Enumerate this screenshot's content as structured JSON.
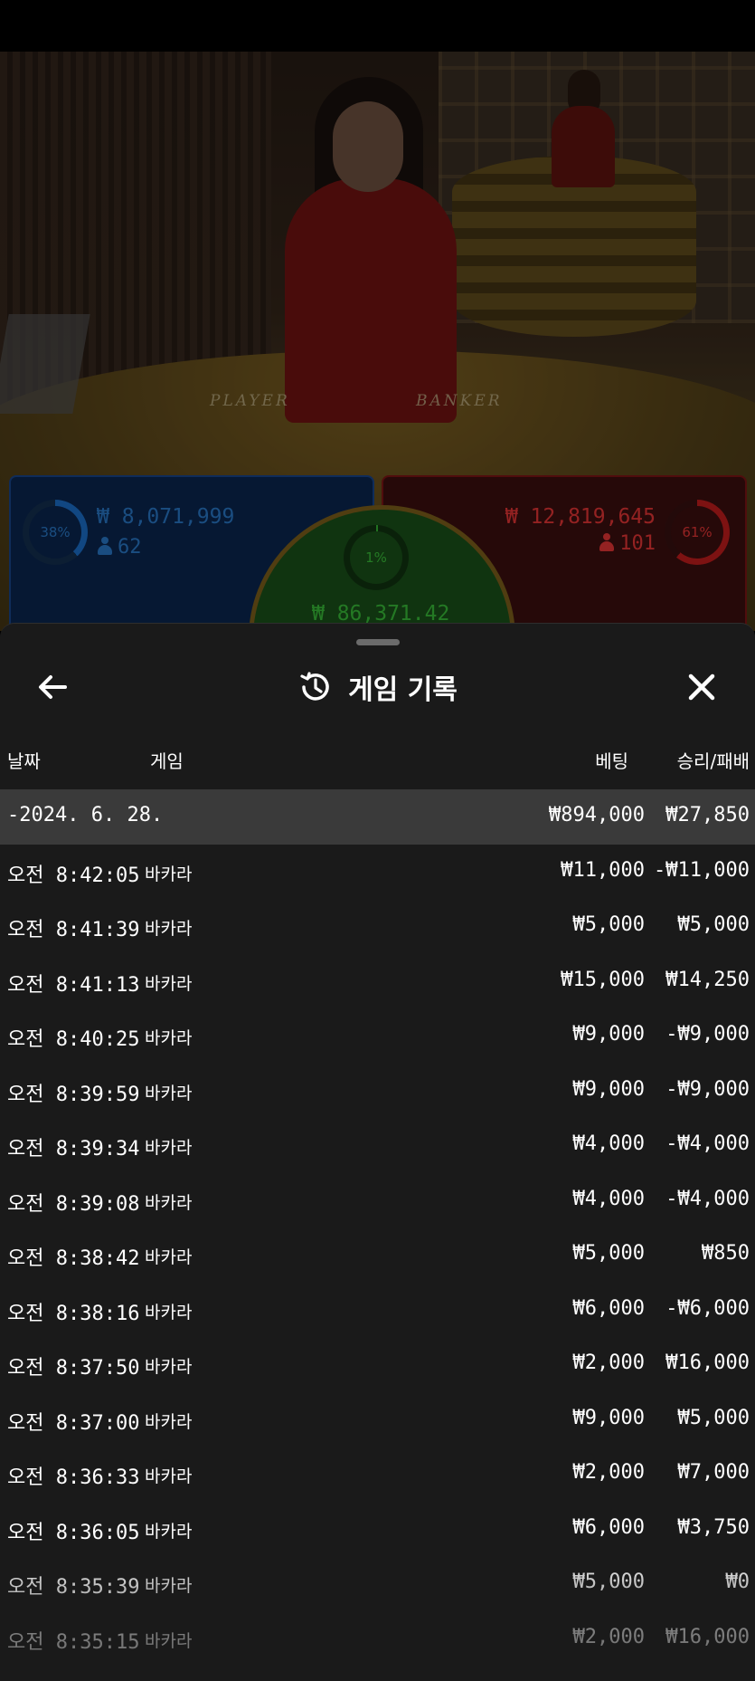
{
  "bets": {
    "player": {
      "percent": "38%",
      "amount": "₩ 8,071,999",
      "players": "62",
      "color": "#1e7be0"
    },
    "banker": {
      "percent": "61%",
      "amount": "₩ 12,819,645",
      "players": "101",
      "color": "#d71f1f"
    },
    "tie": {
      "percent": "1%",
      "amount": "₩ 86,371.42",
      "color": "#39c639"
    }
  },
  "table_labels": {
    "player": "PLAYER",
    "banker": "BANKER"
  },
  "history": {
    "title": "게임 기록",
    "columns": {
      "date": "날짜",
      "game": "게임",
      "bet": "베팅",
      "result": "승리/패배"
    },
    "summary": {
      "date": "-2024. 6. 28.",
      "bet": "₩894,000",
      "result": "₩27,850"
    },
    "rows": [
      {
        "time": "오전 8:42:05",
        "game": "바카라",
        "bet": "₩11,000",
        "result": "-₩11,000"
      },
      {
        "time": "오전 8:41:39",
        "game": "바카라",
        "bet": "₩5,000",
        "result": "₩5,000"
      },
      {
        "time": "오전 8:41:13",
        "game": "바카라",
        "bet": "₩15,000",
        "result": "₩14,250"
      },
      {
        "time": "오전 8:40:25",
        "game": "바카라",
        "bet": "₩9,000",
        "result": "-₩9,000"
      },
      {
        "time": "오전 8:39:59",
        "game": "바카라",
        "bet": "₩9,000",
        "result": "-₩9,000"
      },
      {
        "time": "오전 8:39:34",
        "game": "바카라",
        "bet": "₩4,000",
        "result": "-₩4,000"
      },
      {
        "time": "오전 8:39:08",
        "game": "바카라",
        "bet": "₩4,000",
        "result": "-₩4,000"
      },
      {
        "time": "오전 8:38:42",
        "game": "바카라",
        "bet": "₩5,000",
        "result": "₩850"
      },
      {
        "time": "오전 8:38:16",
        "game": "바카라",
        "bet": "₩6,000",
        "result": "-₩6,000"
      },
      {
        "time": "오전 8:37:50",
        "game": "바카라",
        "bet": "₩2,000",
        "result": "₩16,000"
      },
      {
        "time": "오전 8:37:00",
        "game": "바카라",
        "bet": "₩9,000",
        "result": "₩5,000"
      },
      {
        "time": "오전 8:36:33",
        "game": "바카라",
        "bet": "₩2,000",
        "result": "₩7,000"
      },
      {
        "time": "오전 8:36:05",
        "game": "바카라",
        "bet": "₩6,000",
        "result": "₩3,750"
      },
      {
        "time": "오전 8:35:39",
        "game": "바카라",
        "bet": "₩5,000",
        "result": "₩0"
      },
      {
        "time": "오전 8:35:15",
        "game": "바카라",
        "bet": "₩2,000",
        "result": "₩16,000"
      }
    ]
  },
  "icons": {
    "back": "arrow-left-icon",
    "history": "history-clock-icon",
    "close": "close-icon",
    "player_count": "person-icon"
  }
}
